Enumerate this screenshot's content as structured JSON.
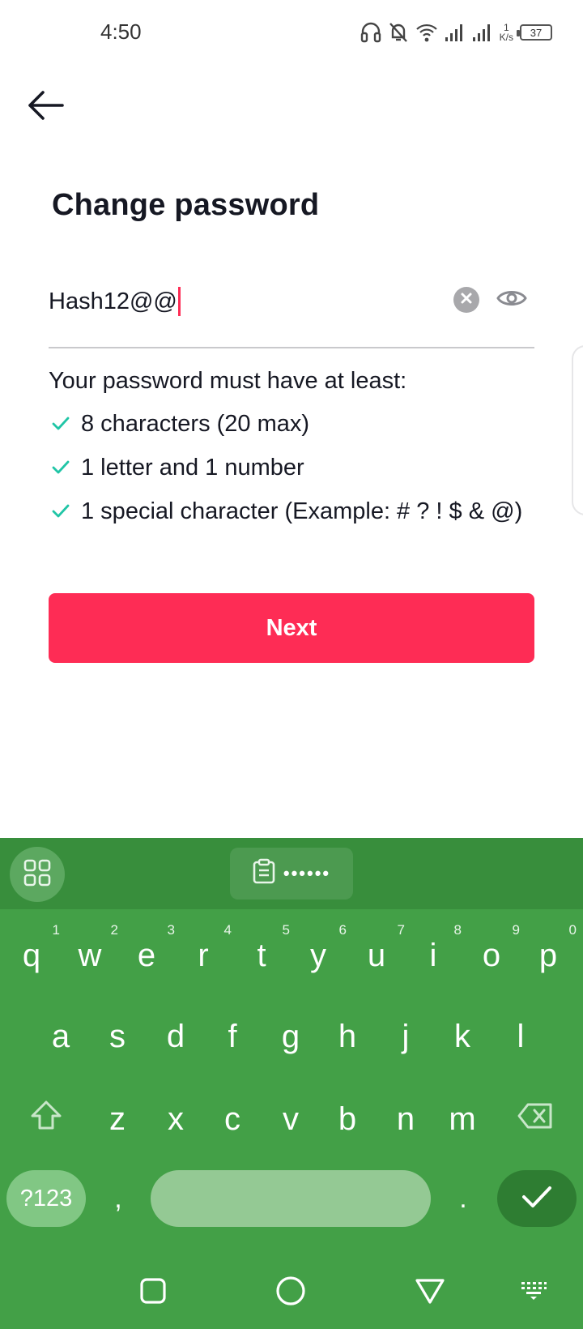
{
  "status_bar": {
    "time": "4:50",
    "net_speed_value": "1",
    "net_speed_unit": "K/s",
    "battery": "37",
    "icons": [
      "headphones-icon",
      "bell-off-icon",
      "wifi-icon",
      "signal-icon",
      "signal-icon"
    ]
  },
  "header": {
    "back_icon": "arrow-left-icon",
    "title": "Change password"
  },
  "password_field": {
    "value": "Hash12@@",
    "clear_icon": "clear-icon",
    "visibility_icon": "eye-icon",
    "cursor_color": "#fe2c55"
  },
  "requirements": {
    "heading": "Your password must have at least:",
    "items": [
      {
        "text": "8 characters (20 max)",
        "met": true
      },
      {
        "text": "1 letter and 1 number",
        "met": true
      },
      {
        "text": "1 special character (Example: # ? ! $ & @)",
        "met": true
      }
    ],
    "check_color": "#20c5a6"
  },
  "next_button": {
    "label": "Next",
    "color": "#fe2c55"
  },
  "keyboard": {
    "toolbar_clipboard_text": "••••••",
    "row1": [
      {
        "key": "q",
        "hint": "1"
      },
      {
        "key": "w",
        "hint": "2"
      },
      {
        "key": "e",
        "hint": "3"
      },
      {
        "key": "r",
        "hint": "4"
      },
      {
        "key": "t",
        "hint": "5"
      },
      {
        "key": "y",
        "hint": "6"
      },
      {
        "key": "u",
        "hint": "7"
      },
      {
        "key": "i",
        "hint": "8"
      },
      {
        "key": "o",
        "hint": "9"
      },
      {
        "key": "p",
        "hint": "0"
      }
    ],
    "row2": [
      "a",
      "s",
      "d",
      "f",
      "g",
      "h",
      "j",
      "k",
      "l"
    ],
    "row3": [
      "z",
      "x",
      "c",
      "v",
      "b",
      "n",
      "m"
    ],
    "symbols_label": "?123",
    "comma": ",",
    "period": ".",
    "background": "#43a047"
  }
}
